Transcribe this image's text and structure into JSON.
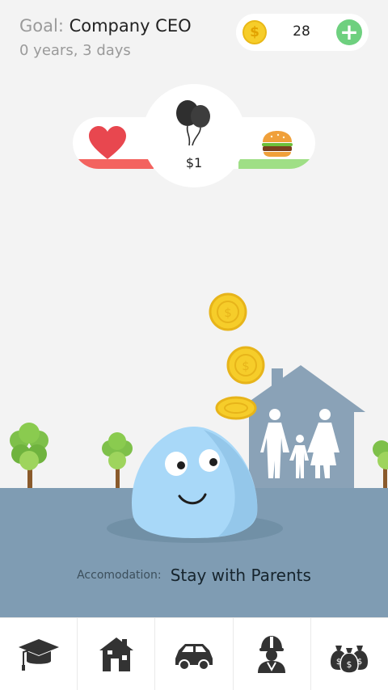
{
  "header": {
    "goal_label": "Goal:",
    "goal_value": "Company CEO",
    "age": "0 years, 3 days"
  },
  "coins": {
    "symbol": "$",
    "count": "28",
    "add_label": "+"
  },
  "stats": {
    "money": "$1",
    "health_icon": "heart-icon",
    "food_icon": "burger-icon",
    "money_icon": "balloons-icon",
    "health_color": "#f3635f",
    "food_color": "#9fdf86"
  },
  "scene": {
    "accommodation_label": "Accomodation:",
    "accommodation_value": "Stay with Parents"
  },
  "nav": {
    "items": [
      {
        "name": "education",
        "icon": "graduation-cap-icon"
      },
      {
        "name": "housing",
        "icon": "house-icon"
      },
      {
        "name": "transport",
        "icon": "car-icon"
      },
      {
        "name": "job",
        "icon": "worker-icon"
      },
      {
        "name": "money",
        "icon": "money-bags-icon"
      }
    ]
  },
  "colors": {
    "background": "#f3f3f3",
    "ground": "#7f9cb3",
    "house": "#8aa2b7",
    "blob": "#a8d8f8",
    "coin": "#f6cd2a",
    "add": "#6ed07f"
  }
}
